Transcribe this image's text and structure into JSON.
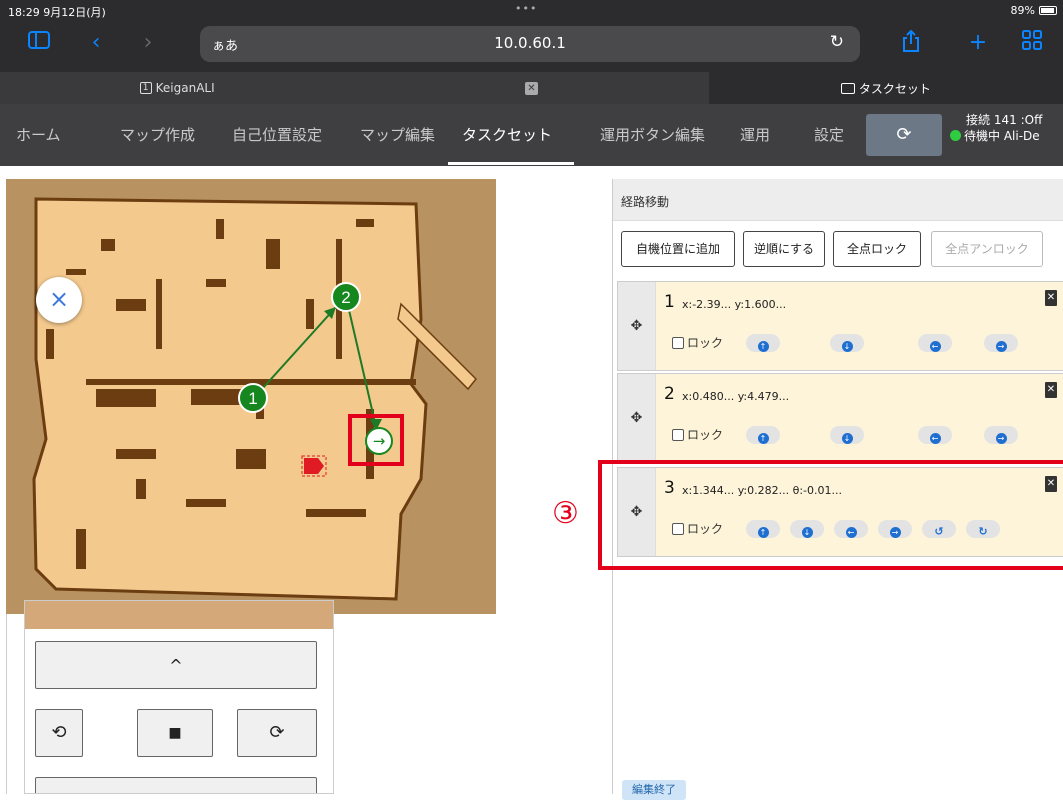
{
  "status_bar": {
    "time": "18:29",
    "date": "9月12日(月)",
    "dots": "•••",
    "battery": "89%"
  },
  "safari": {
    "aa_label": "ぁあ",
    "url": "10.0.60.1"
  },
  "browser_tabs": [
    {
      "label": "KeiganALI",
      "badge": "1"
    },
    {
      "label": ""
    },
    {
      "label": "タスクセット"
    }
  ],
  "nav": {
    "items": [
      "ホーム",
      "マップ作成",
      "自己位置設定",
      "マップ編集",
      "タスクセット",
      "運用ボタン編集",
      "運用",
      "設定"
    ],
    "active": "タスクセット",
    "connection_label": "接続",
    "connection_value": "141",
    "connection_state": ":Off",
    "status": "待機中",
    "robot_name": "Ali-De"
  },
  "map": {
    "waypoints": [
      "1",
      "2"
    ],
    "path_colors": {
      "node": "#16871f",
      "arrow": "#1f7a26",
      "robot": "#e01b24"
    }
  },
  "controls": {
    "forward": "^",
    "rotate_left": "⟲",
    "stop": "■",
    "rotate_right": "⟳"
  },
  "panel": {
    "title": "経路移動",
    "buttons": {
      "add_self": "自機位置に追加",
      "reverse": "逆順にする",
      "lock_all": "全点ロック",
      "unlock_all": "全点アンロック"
    },
    "waypoints": [
      {
        "num": "1",
        "coords": "x:-2.39... y:1.600...",
        "lock": "ロック"
      },
      {
        "num": "2",
        "coords": "x:0.480... y:4.479...",
        "lock": "ロック"
      },
      {
        "num": "3",
        "coords": "x:1.344... y:0.282... θ:-0.01...",
        "lock": "ロック"
      }
    ],
    "edit_end": "編集終了"
  },
  "annotation": {
    "label": "③",
    "color": "#e3001b"
  }
}
